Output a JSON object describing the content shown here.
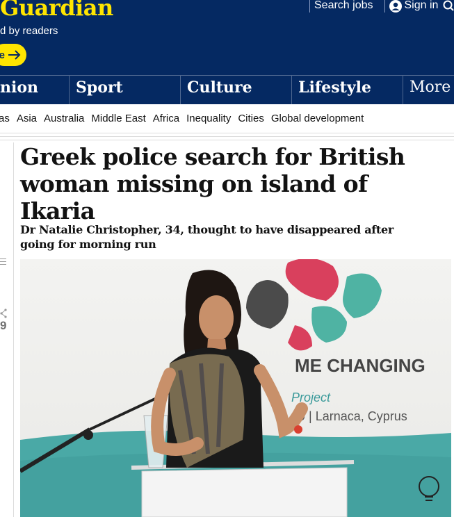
{
  "masthead": {
    "logo_text": "Guardian",
    "tagline": "d by readers",
    "support_button_label": "e",
    "top_links": [
      {
        "label": "Search jobs"
      },
      {
        "label": "Sign in"
      }
    ]
  },
  "pillars": [
    {
      "label": "nion"
    },
    {
      "label": "Sport"
    },
    {
      "label": "Culture"
    },
    {
      "label": "Lifestyle"
    },
    {
      "label": "More"
    }
  ],
  "subnav": [
    "as",
    "Asia",
    "Australia",
    "Middle East",
    "Africa",
    "Inequality",
    "Cities",
    "Global development"
  ],
  "article": {
    "headline": "Greek police search for British woman missing on island of Ikaria",
    "standfirst": "Dr Natalie Christopher, 34, thought to have disappeared after going for morning run",
    "share_count": "9",
    "image": {
      "banner_text_1": "ME CHANGING",
      "banner_text_2": "Project",
      "banner_text_3": "9 | Larnaca, Cyprus"
    }
  },
  "colors": {
    "brand_blue": "#052962",
    "brand_yellow": "#ffe500",
    "pillar_divider": "#506991"
  }
}
